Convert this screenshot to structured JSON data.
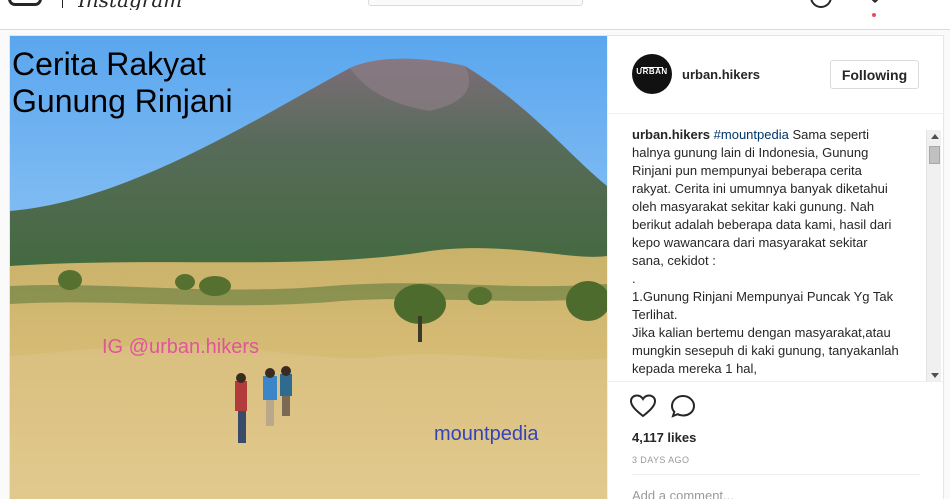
{
  "colors": {
    "accent": "#3897f0",
    "border": "#dbdbdb",
    "text": "#262626",
    "muted": "#999999",
    "notification": "#ed4956"
  },
  "nav": {
    "wordmark": "Instagram",
    "icons": [
      "camera-logo-icon",
      "compass-icon",
      "heart-icon",
      "profile-icon"
    ]
  },
  "post": {
    "image_title": [
      "Cerita Rakyat",
      "Gunung Rinjani"
    ],
    "image_watermark_ig": "IG @urban.hikers",
    "image_watermark_brand": "mountpedia",
    "header": {
      "avatar_text": "URBAN",
      "username": "urban.hikers",
      "follow_label": "Following"
    },
    "caption": {
      "username": "urban.hikers",
      "hashtag": "#mountpedia",
      "text": " Sama seperti halnya gunung lain di Indonesia, Gunung Rinjani pun mempunyai beberapa cerita rakyat. Cerita ini umumnya banyak diketahui oleh masyarakat sekitar kaki gunung. Nah berikut adalah beberapa data kami, hasil dari kepo wawancara dari masyarakat sekitar sana, cekidot :\n.\n1.Gunung Rinjani Mempunyai Puncak Yg Tak Terlihat.\nJika kalian bertemu dengan masyarakat,atau mungkin sesepuh di kaki gunung, tanyakanlah kepada mereka 1 hal,"
    },
    "likes": "4,117 likes",
    "timestamp": "3 DAYS AGO",
    "comment_placeholder": "Add a comment..."
  }
}
